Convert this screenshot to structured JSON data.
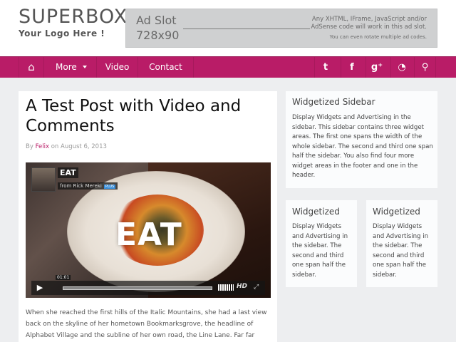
{
  "header": {
    "logo_title": "SUPERBOX",
    "logo_subtitle": "Your Logo Here !",
    "ad": {
      "title": "Ad Slot",
      "size": "728x90",
      "text_line1": "Any XHTML, IFrame, JavaScript and/or",
      "text_line2": "AdSense code will work in this ad slot.",
      "text_line3": "You can even rotate multiple ad codes."
    }
  },
  "nav": {
    "items": [
      {
        "label": "More"
      },
      {
        "label": "Video"
      },
      {
        "label": "Contact"
      }
    ],
    "icons": [
      "home-icon",
      "twitter-icon",
      "facebook-icon",
      "google-plus-icon",
      "rss-icon",
      "search-icon"
    ],
    "glyphs": {
      "home": "⌂",
      "twitter": "t",
      "facebook": "f",
      "google_plus": "g⁺",
      "rss": "◔",
      "search": "⚲"
    },
    "background": "#b91c67"
  },
  "post": {
    "title": "A Test Post with Video and Comments",
    "by": "By",
    "author": "Felix",
    "on": "on",
    "date": "August 6, 2013",
    "video": {
      "channel_title": "EAT",
      "from_text": "from Rick Mereki",
      "pro_badge": "PLUS",
      "overlay_title": "EAT",
      "time": "01:01",
      "hd_label": "HD",
      "play_glyph": "▶",
      "fullscreen_glyph": "⤢"
    },
    "body": "When she reached the first hills of the Italic Mountains, she had a last view back on the skyline of her hometown Bookmarksgrove, the headline of Alphabet Village and the subline of her own road, the Line Lane. Far far away,"
  },
  "sidebar": {
    "main": {
      "title": "Widgetized Sidebar",
      "text": "Display Widgets and Advertising in the sidebar. This sidebar contains three widget areas. The first one spans the width of the whole sidebar. The second and third one span half the sidebar. You also find four more widget areas in the footer and one in the header."
    },
    "left": {
      "title": "Widgetized",
      "text": "Display Widgets and Advertising in the sidebar. The second and third one span half the sidebar."
    },
    "right": {
      "title": "Widgetized",
      "text": "Display Widgets and Advertising in the sidebar. The second and third one span half the sidebar."
    }
  },
  "colors": {
    "accent": "#b91c67",
    "background": "#edeef0"
  }
}
